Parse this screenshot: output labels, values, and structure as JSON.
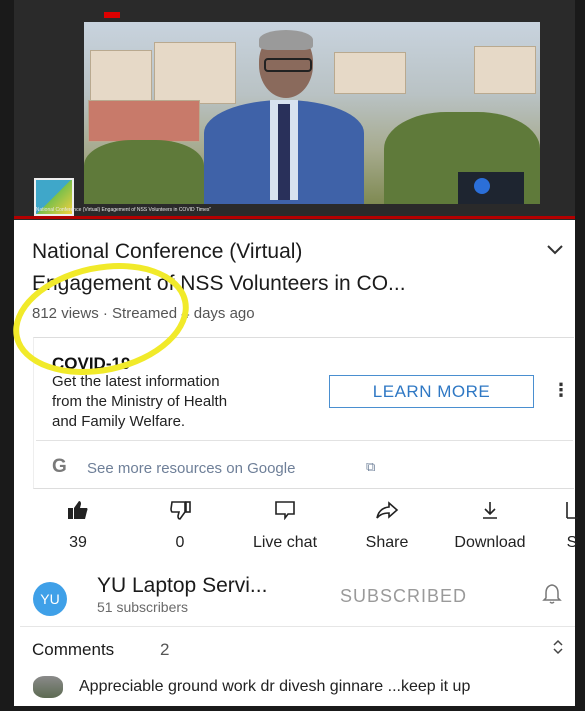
{
  "video": {
    "ticker_text": "\"National Conference (Virtual) Engagement of NSS Volunteers in COVID Times\"",
    "progress_color": "#b40000"
  },
  "title": {
    "line1": "National Conference (Virtual)",
    "line2": "Engagement of NSS Volunteers in CO...",
    "expand_icon": "chevron-down-icon"
  },
  "meta": {
    "views_text": "812 views · Streamed 4 days ago"
  },
  "covid": {
    "heading": "COVID-19",
    "body_line1": "Get the latest information",
    "body_line2": "from the Ministry of Health",
    "body_line3": "and Family Welfare.",
    "button_label": "LEARN MORE",
    "google_link": "See more resources on Google",
    "g_glyph": "G",
    "ext_glyph": "⧉",
    "kebab_glyph": "⋮"
  },
  "actions": {
    "like": {
      "label": "39",
      "icon": "thumbs-up-icon",
      "glyph": "👍"
    },
    "dislike": {
      "label": "0",
      "icon": "thumbs-down-icon",
      "glyph": "👎"
    },
    "live_chat": {
      "label": "Live chat",
      "icon": "chat-icon",
      "glyph": "🗨"
    },
    "share": {
      "label": "Share",
      "icon": "share-icon",
      "glyph": "➦"
    },
    "download": {
      "label": "Download",
      "icon": "download-icon",
      "glyph": "⤓"
    },
    "save": {
      "label": "S",
      "icon": "save-icon",
      "glyph": "▥"
    }
  },
  "channel": {
    "avatar_text": "YU",
    "name": "YU Laptop Servi...",
    "subscribers": "51 subscribers",
    "subscribe_state": "SUBSCRIBED",
    "bell_glyph": "🔔",
    "avatar_color": "#3fa0e8"
  },
  "comments": {
    "label": "Comments",
    "count": "2",
    "expand_glyph": "⌃⌄",
    "top_comment": "Appreciable ground work dr divesh ginnare ...keep it up"
  },
  "annotation": {
    "highlight_color": "#f1ea2a"
  }
}
